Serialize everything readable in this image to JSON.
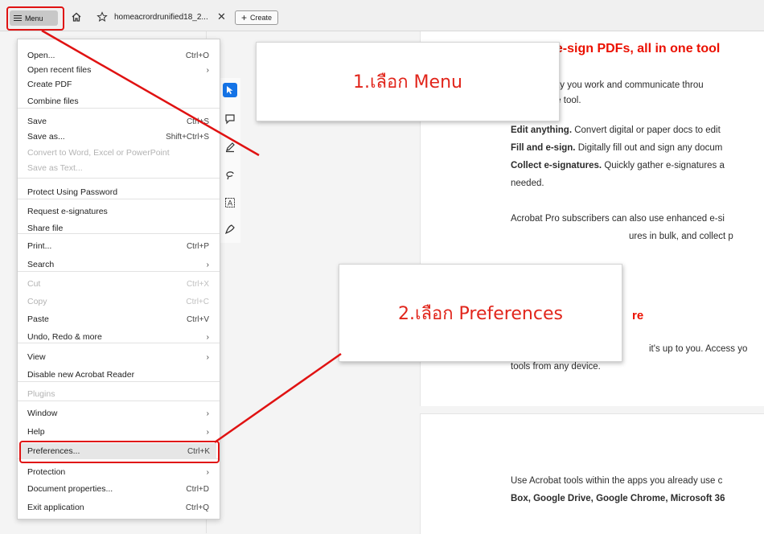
{
  "topbar": {
    "menu_label": "Menu",
    "tab_title": "homeacrordrunified18_2...",
    "tab_close": "✕",
    "create_label": "Create",
    "icons": [
      "hamburger-icon",
      "home-icon",
      "star-icon",
      "close-icon",
      "plus-icon"
    ]
  },
  "menu": {
    "items": [
      {
        "label": "Open...",
        "shortcut": "Ctrl+O",
        "disabled": false
      },
      {
        "label": "Open recent files",
        "shortcut": "›",
        "disabled": false
      },
      {
        "label": "Create PDF",
        "shortcut": "",
        "disabled": false
      },
      {
        "label": "Combine files",
        "shortcut": "",
        "disabled": false
      },
      {
        "label": "Save",
        "shortcut": "Ctrl+S",
        "disabled": false
      },
      {
        "label": "Save as...",
        "shortcut": "Shift+Ctrl+S",
        "disabled": false
      },
      {
        "label": "Convert to Word, Excel or PowerPoint",
        "shortcut": "",
        "disabled": true
      },
      {
        "label": "Save as Text...",
        "shortcut": "",
        "disabled": true
      },
      {
        "label": "Protect Using Password",
        "shortcut": "",
        "disabled": false
      },
      {
        "label": "Request e-signatures",
        "shortcut": "",
        "disabled": false
      },
      {
        "label": "Share file",
        "shortcut": "",
        "disabled": false
      },
      {
        "label": "Print...",
        "shortcut": "Ctrl+P",
        "disabled": false
      },
      {
        "label": "Search",
        "shortcut": "›",
        "disabled": false
      },
      {
        "label": "Cut",
        "shortcut": "Ctrl+X",
        "disabled": true
      },
      {
        "label": "Copy",
        "shortcut": "Ctrl+C",
        "disabled": true
      },
      {
        "label": "Paste",
        "shortcut": "Ctrl+V",
        "disabled": false
      },
      {
        "label": "Undo, Redo & more",
        "shortcut": "›",
        "disabled": false
      },
      {
        "label": "View",
        "shortcut": "›",
        "disabled": false
      },
      {
        "label": "Disable new Acrobat Reader",
        "shortcut": "",
        "disabled": false
      },
      {
        "label": "Plugins",
        "shortcut": "",
        "disabled": true
      },
      {
        "label": "Window",
        "shortcut": "›",
        "disabled": false
      },
      {
        "label": "Help",
        "shortcut": "›",
        "disabled": false
      },
      {
        "label": "Preferences...",
        "shortcut": "Ctrl+K",
        "disabled": false
      },
      {
        "label": "Protection",
        "shortcut": "›",
        "disabled": false
      },
      {
        "label": "Document properties...",
        "shortcut": "Ctrl+D",
        "disabled": false
      },
      {
        "label": "Exit application",
        "shortcut": "Ctrl+Q",
        "disabled": false
      }
    ]
  },
  "tools": [
    "select-tool-icon",
    "comment-icon",
    "pen-icon",
    "lasso-icon",
    "text-select-icon",
    "sign-icon"
  ],
  "document": {
    "heading1": "l e-sign PDFs, all in one tool",
    "line1": "e way you work and communicate throu",
    "line2": "t one tool.",
    "edit_bold": "Edit anything.",
    "edit_text": " Convert digital or paper docs to edit",
    "fill_bold": "Fill and e-sign.",
    "fill_text": " Digitally fill out and sign any docum",
    "collect_bold": "Collect e-signatures.",
    "collect_text": " Quickly gather e-signatures a",
    "needed": "needed.",
    "pro_line": "Acrobat Pro subscribers can also use enhanced e-si",
    "bulk_line": "ures in bulk, and collect p",
    "heading2": "re",
    "access_line": "it's up to you. Access yo",
    "tools_line": "tools from any device.",
    "use_line": "Use Acrobat tools within the apps you already use c",
    "box_line": "Box, Google Drive, Google Chrome, Microsoft 36"
  },
  "callouts": {
    "step1": "1.เลือก Menu",
    "step2": "2.เลือก Preferences"
  },
  "colors": {
    "annotation_red": "#e01212",
    "accent_blue": "#1473e6",
    "heading_red": "#eb1000"
  }
}
